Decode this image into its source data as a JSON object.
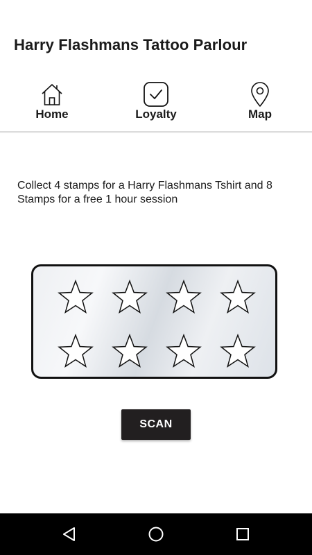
{
  "app": {
    "title": "Harry Flashmans Tattoo Parlour"
  },
  "tabs": [
    {
      "label": "Home",
      "icon": "home-icon",
      "active": false
    },
    {
      "label": "Loyalty",
      "icon": "checkbox-icon",
      "active": true
    },
    {
      "label": "Map",
      "icon": "map-pin-icon",
      "active": false
    }
  ],
  "loyalty": {
    "description": "Collect 4 stamps for a Harry Flashmans Tshirt and 8 Stamps for a free 1 hour session",
    "stamps_total": 8,
    "stamps_collected": 0,
    "scan_label": "SCAN"
  },
  "navigation": {
    "buttons": [
      "back-icon",
      "home-circle-icon",
      "recents-icon"
    ]
  },
  "colors": {
    "accent": "#d0202e",
    "button": "#221f20",
    "navbar": "#000000"
  }
}
